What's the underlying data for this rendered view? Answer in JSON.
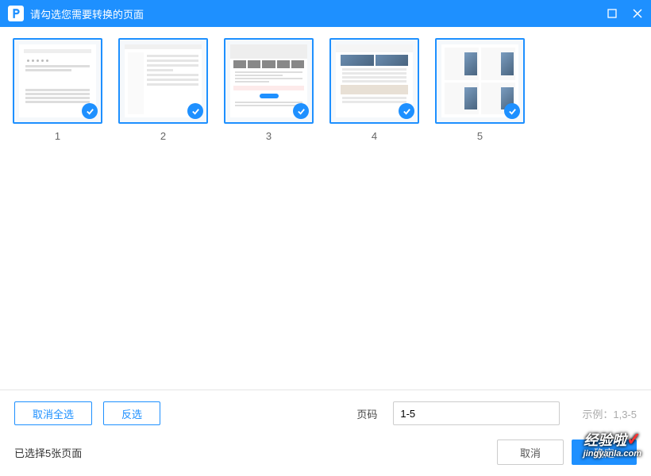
{
  "window": {
    "title": "请勾选您需要转换的页面"
  },
  "thumbs": [
    {
      "label": "1"
    },
    {
      "label": "2"
    },
    {
      "label": "3"
    },
    {
      "label": "4"
    },
    {
      "label": "5"
    }
  ],
  "footer": {
    "deselect_all": "取消全选",
    "invert": "反选",
    "page_label": "页码",
    "page_value": "1-5",
    "hint": "示例：1,3-5",
    "status": "已选择5张页面",
    "cancel": "取消",
    "confirm": "确定"
  },
  "watermark": {
    "line1": "经验啦",
    "line2": "jingyanla.com"
  }
}
